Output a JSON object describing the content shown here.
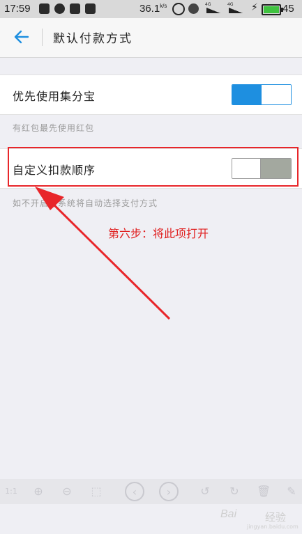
{
  "status_bar": {
    "time": "17:59",
    "network_speed": "36.1",
    "speed_unit": "k/s",
    "signal_label_1": "4G",
    "signal_label_2": "4G",
    "battery_level": "45",
    "battery_color": "#3fc23f"
  },
  "nav": {
    "back_icon": "back-arrow-icon",
    "title": "默认付款方式"
  },
  "settings": [
    {
      "label": "优先使用集分宝",
      "state": "on",
      "hint": "有红包最先使用红包"
    },
    {
      "label": "自定义扣款顺序",
      "state": "off",
      "hint": "如不开启，系统将自动选择支付方式"
    }
  ],
  "annotation": {
    "text": "第六步：将此项打开",
    "color": "#e8262a"
  },
  "toolbar_icons": [
    "actual-size-icon",
    "zoom-in-icon",
    "zoom-out-icon",
    "fit-icon",
    "prev-icon",
    "next-icon",
    "rotate-left-icon",
    "rotate-right-icon",
    "delete-icon",
    "edit-icon"
  ],
  "watermark": {
    "brand": "Bai",
    "sub": "经验",
    "url": "jingyan.baidu.com"
  },
  "colors": {
    "accent": "#1e8fe0",
    "toggle_off": "#a3a89f"
  }
}
